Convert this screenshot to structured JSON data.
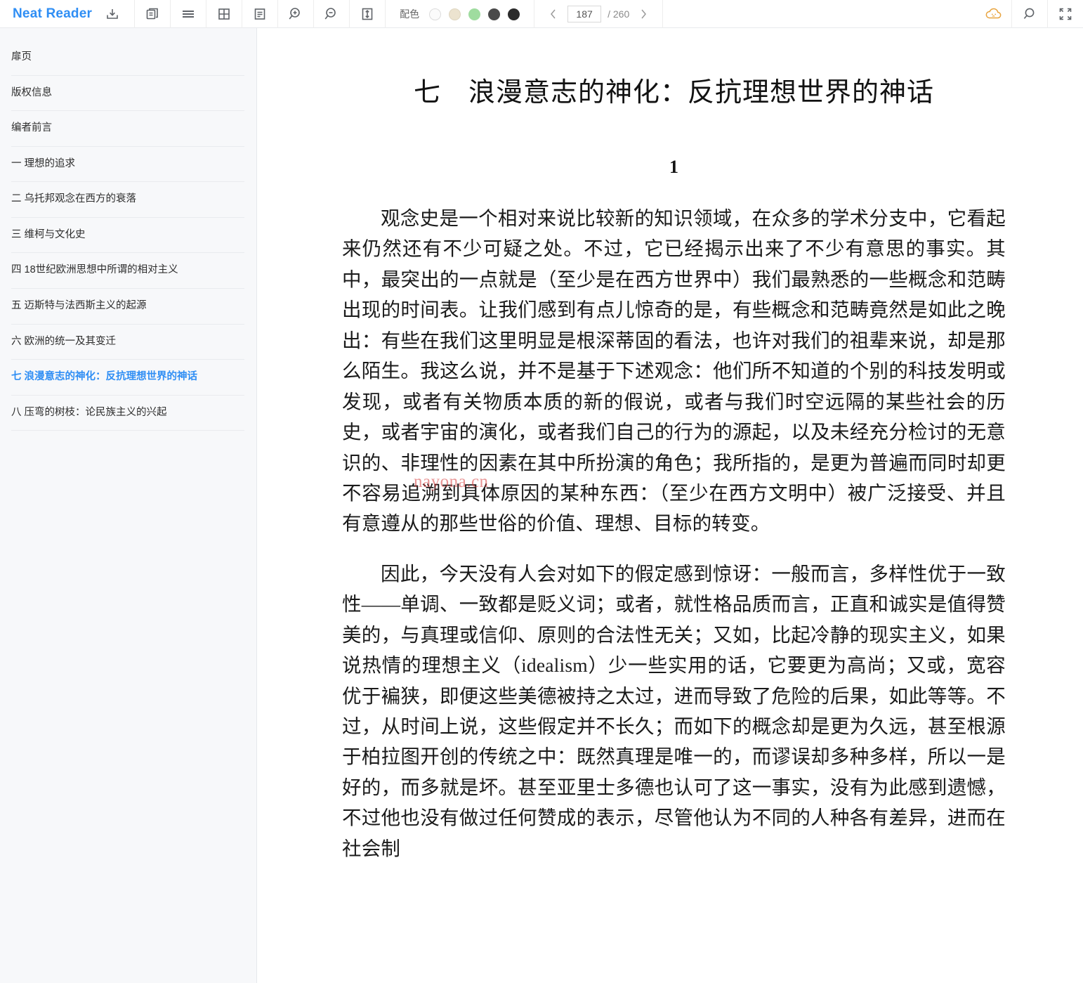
{
  "app": {
    "brand": "Neat Reader",
    "brand_color": "#2f8ef4"
  },
  "toolbar": {
    "icons": {
      "save": "save-icon",
      "copy_pages": "copy-pages-icon",
      "scroll_mode": "scroll-mode-icon",
      "grid_mode": "grid-mode-icon",
      "notes": "notes-icon",
      "zoom_in": "zoom-in-icon",
      "zoom_out": "zoom-out-icon",
      "line_height": "line-height-icon",
      "cloud_sync": "cloud-icon",
      "search": "search-icon",
      "fullscreen": "fullscreen-icon"
    },
    "color_scheme": {
      "label": "配色",
      "swatches": [
        "#fbfbfb",
        "#ece3cf",
        "#9fdc9f",
        "#4a4a4a",
        "#2b2b2b"
      ],
      "selected_index": 0
    },
    "pager": {
      "prev": "‹",
      "next": "›",
      "current_page": "187",
      "total_label": "/ 260",
      "total_pages": "260"
    },
    "cloud_color": "#e8a33d"
  },
  "sidebar": {
    "items": [
      {
        "label": "扉页",
        "active": false
      },
      {
        "label": "版权信息",
        "active": false
      },
      {
        "label": "编者前言",
        "active": false
      },
      {
        "label": "一 理想的追求",
        "active": false
      },
      {
        "label": "二 乌托邦观念在西方的衰落",
        "active": false
      },
      {
        "label": "三 维柯与文化史",
        "active": false
      },
      {
        "label": "四 18世纪欧洲思想中所谓的相对主义",
        "active": false
      },
      {
        "label": "五 迈斯特与法西斯主义的起源",
        "active": false
      },
      {
        "label": "六 欧洲的统一及其变迁",
        "active": false
      },
      {
        "label": "七 浪漫意志的神化：反抗理想世界的神话",
        "active": true
      },
      {
        "label": "八 压弯的树枝：论民族主义的兴起",
        "active": false
      }
    ]
  },
  "content": {
    "chapter_title": "七　浪漫意志的神化：反抗理想世界的神话",
    "section_number": "1",
    "paragraphs": [
      "观念史是一个相对来说比较新的知识领域，在众多的学术分支中，它看起来仍然还有不少可疑之处。不过，它已经揭示出来了不少有意思的事实。其中，最突出的一点就是（至少是在西方世界中）我们最熟悉的一些概念和范畴出现的时间表。让我们感到有点儿惊奇的是，有些概念和范畴竟然是如此之晚出：有些在我们这里明显是根深蒂固的看法，也许对我们的祖辈来说，却是那么陌生。我这么说，并不是基于下述观念：他们所不知道的个别的科技发明或发现，或者有关物质本质的新的假说，或者与我们时空远隔的某些社会的历史，或者宇宙的演化，或者我们自己的行为的源起，以及未经充分检讨的无意识的、非理性的因素在其中所扮演的角色；我所指的，是更为普遍而同时却更不容易追溯到具体原因的某种东西：（至少在西方文明中）被广泛接受、并且有意遵从的那些世俗的价值、理想、目标的转变。",
      "因此，今天没有人会对如下的假定感到惊讶：一般而言，多样性优于一致性——单调、一致都是贬义词；或者，就性格品质而言，正直和诚实是值得赞美的，与真理或信仰、原则的合法性无关；又如，比起冷静的现实主义，如果说热情的理想主义（idealism）少一些实用的话，它要更为高尚；又或，宽容优于褊狭，即便这些美德被持之太过，进而导致了危险的后果，如此等等。不过，从时间上说，这些假定并不长久；而如下的概念却是更为久远，甚至根源于柏拉图开创的传统之中：既然真理是唯一的，而谬误却多种多样，所以一是好的，而多就是坏。甚至亚里士多德也认可了这一事实，没有为此感到遗憾，不过他也没有做过任何赞成的表示，尽管他认为不同的人种各有差异，进而在社会制"
    ],
    "watermark": "nayona.cn"
  }
}
